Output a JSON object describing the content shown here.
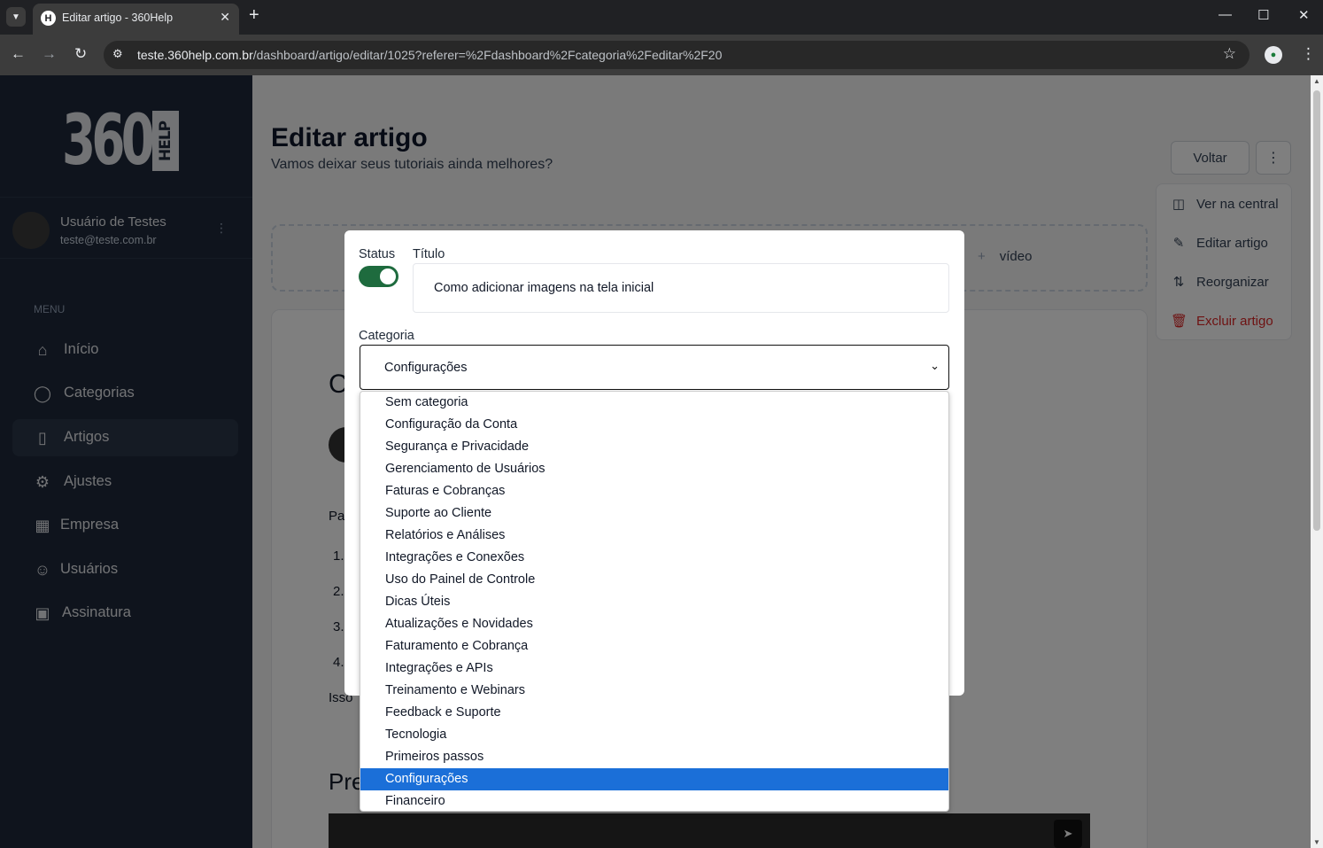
{
  "browser": {
    "tab_title": "Editar artigo - 360Help",
    "tab_favicon": "H",
    "url_host": "teste.360help.com.br",
    "url_path": "/dashboard/artigo/editar/1025?referer=%2Fdashboard%2Fcategoria%2Feditar%2F20"
  },
  "sidebar": {
    "logo_number": "360",
    "logo_help": "HELP",
    "user_name": "Usuário de Testes",
    "user_email": "teste@teste.com.br",
    "menu_label": "MENU",
    "items": [
      {
        "label": "Início",
        "icon": "home-icon",
        "active": false
      },
      {
        "label": "Categorias",
        "icon": "tag-icon",
        "active": false
      },
      {
        "label": "Artigos",
        "icon": "bookmark-icon",
        "active": true
      },
      {
        "label": "Ajustes",
        "icon": "gear-icon",
        "active": false
      },
      {
        "label": "Empresa",
        "icon": "building-icon",
        "active": false
      },
      {
        "label": "Usuários",
        "icon": "users-icon",
        "active": false
      },
      {
        "label": "Assinatura",
        "icon": "wallet-icon",
        "active": false
      }
    ]
  },
  "header": {
    "title": "Editar artigo",
    "subtitle": "Vamos deixar seus tutoriais ainda melhores?",
    "back_label": "Voltar"
  },
  "actions_menu": [
    {
      "label": "Ver na central",
      "icon": "book-icon"
    },
    {
      "label": "Editar artigo",
      "icon": "pencil-icon"
    },
    {
      "label": "Reorganizar",
      "icon": "reorder-icon"
    },
    {
      "label": "Excluir artigo",
      "icon": "trash-icon",
      "danger": true
    }
  ],
  "background": {
    "dropzone_video": "vídeo",
    "card_heading_fragment": "C",
    "para_fragment": "Pa",
    "list_markers": [
      "1.",
      "2.",
      "3.",
      "4."
    ],
    "isso_fragment": "Isso",
    "section_fragment": "Pre"
  },
  "modal": {
    "status_label": "Status",
    "status_on": true,
    "title_label": "Título",
    "title_value": "Como adicionar imagens na tela inicial",
    "category_label": "Categoria",
    "category_value": "Configurações",
    "options": [
      "Sem categoria",
      "Configuração da Conta",
      "Segurança e Privacidade",
      "Gerenciamento de Usuários",
      "Faturas e Cobranças",
      "Suporte ao Cliente",
      "Relatórios e Análises",
      "Integrações e Conexões",
      "Uso do Painel de Controle",
      "Dicas Úteis",
      "Atualizações e Novidades",
      "Faturamento e Cobrança",
      "Integrações e APIs",
      "Treinamento e Webinars",
      "Feedback e Suporte",
      "Tecnologia",
      "Primeiros passos",
      "Configurações",
      "Financeiro"
    ],
    "selected_index": 17
  },
  "colors": {
    "sidebar_bg": "#1e293b",
    "toggle_on": "#1e6b3e",
    "option_selected": "#1b6fd8",
    "danger": "#dc2626"
  }
}
